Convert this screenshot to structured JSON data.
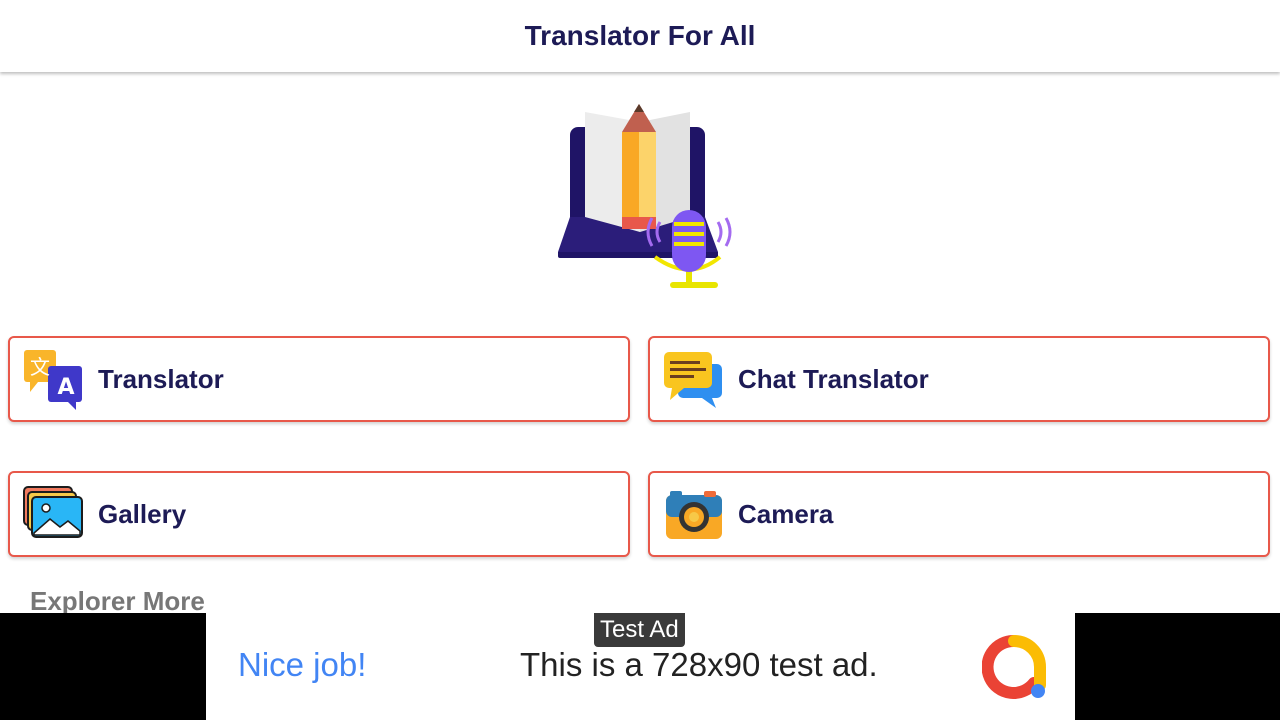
{
  "appbar": {
    "title": "Translator For All"
  },
  "hero": {
    "illustration": "book-pencil-microphone-illustration"
  },
  "cards": [
    {
      "label": "Translator",
      "icon": "translate-icon"
    },
    {
      "label": "Chat Translator",
      "icon": "chat-icon"
    },
    {
      "label": "Gallery",
      "icon": "gallery-icon"
    },
    {
      "label": "Camera",
      "icon": "camera-icon"
    }
  ],
  "section": {
    "explore_label": "Explorer More"
  },
  "ad": {
    "badge": "Test Ad",
    "headline": "Nice job!",
    "body": "This is a 728x90 test ad.",
    "logo": "admob-logo-icon"
  },
  "colors": {
    "title": "#1d1b56",
    "card_border": "#e8584a",
    "ad_headline": "#4285f4"
  }
}
